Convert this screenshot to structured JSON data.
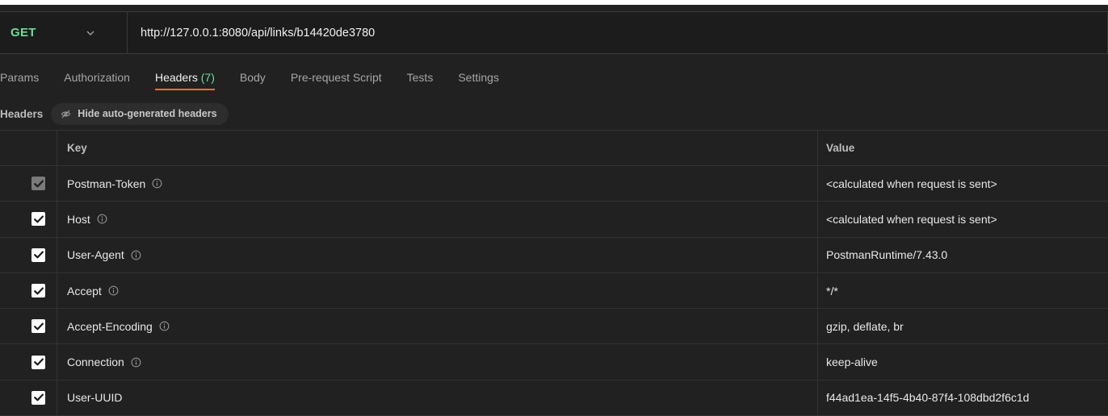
{
  "request": {
    "method": "GET",
    "url": "http://127.0.0.1:8080/api/links/b14420de3780"
  },
  "tabs": [
    {
      "label": "Params"
    },
    {
      "label": "Authorization"
    },
    {
      "label": "Headers",
      "count": "(7)",
      "active": true
    },
    {
      "label": "Body"
    },
    {
      "label": "Pre-request Script"
    },
    {
      "label": "Tests"
    },
    {
      "label": "Settings"
    }
  ],
  "headers_section": {
    "label": "Headers",
    "toggle_label": "Hide auto-generated headers"
  },
  "table": {
    "columns": {
      "key": "Key",
      "value": "Value"
    },
    "rows": [
      {
        "key": "Postman-Token",
        "value": "<calculated when request is sent>",
        "checked": true,
        "disabled": true,
        "info": true
      },
      {
        "key": "Host",
        "value": "<calculated when request is sent>",
        "checked": true,
        "disabled": false,
        "info": true
      },
      {
        "key": "User-Agent",
        "value": "PostmanRuntime/7.43.0",
        "checked": true,
        "disabled": false,
        "info": true
      },
      {
        "key": "Accept",
        "value": "*/*",
        "checked": true,
        "disabled": false,
        "info": true
      },
      {
        "key": "Accept-Encoding",
        "value": "gzip, deflate, br",
        "checked": true,
        "disabled": false,
        "info": true
      },
      {
        "key": "Connection",
        "value": "keep-alive",
        "checked": true,
        "disabled": false,
        "info": true
      },
      {
        "key": "User-UUID",
        "value": "f44ad1ea-14f5-4b40-87f4-108dbd2f6c1d",
        "checked": true,
        "disabled": false,
        "info": false
      }
    ]
  },
  "colors": {
    "method": "#6bdd9a",
    "active_tab_underline": "#ff6c37",
    "background": "#212121"
  },
  "icons": {
    "method_dropdown": "chevron-down-icon",
    "hide_toggle": "eye-off-icon",
    "row_info": "info-icon",
    "checkbox": "checkmark-icon"
  }
}
